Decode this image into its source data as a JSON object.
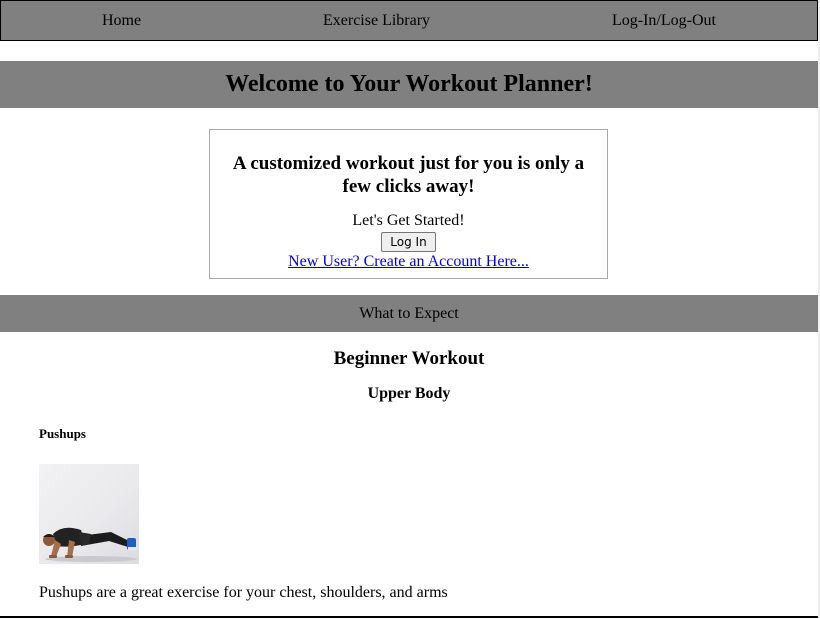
{
  "nav": {
    "home": "Home",
    "library": "Exercise Library",
    "login": "Log-In/Log-Out"
  },
  "welcome": {
    "title": "Welcome to Your Workout Planner!"
  },
  "login_box": {
    "heading": "A customized workout just for you is only a few clicks away!",
    "started": "Let's Get Started!",
    "button": "Log In",
    "signup_link": "New User? Create an Account Here..."
  },
  "expect": {
    "label": "What to Expect"
  },
  "workout": {
    "title": "Beginner Workout",
    "section": "Upper Body",
    "exercise": {
      "name": "Pushups",
      "image_icon": "pushup-photo",
      "description": "Pushups are a great exercise for your chest, shoulders, and arms"
    }
  },
  "colors": {
    "banner_gray": "#808080",
    "link_blue": "#0000ee",
    "box_border": "#a9a9a9"
  }
}
